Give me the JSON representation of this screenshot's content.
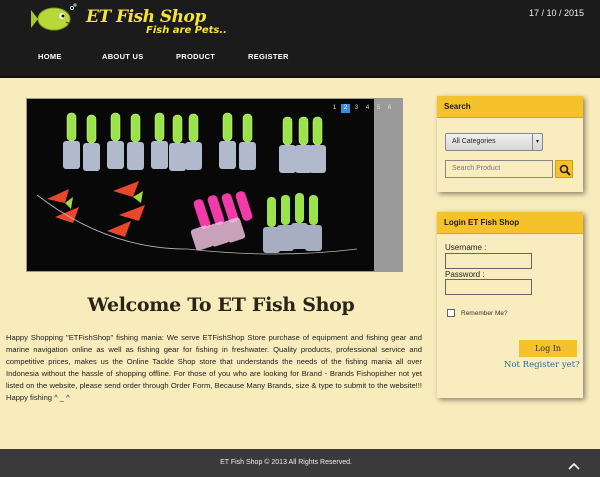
{
  "header": {
    "brand_name": "ET Fish Shop",
    "tagline": "Fish are Pets..",
    "date": "17 / 10 / 2015",
    "nav": [
      {
        "label": "HOME"
      },
      {
        "label": "ABOUT US"
      },
      {
        "label": "PRODUCT"
      },
      {
        "label": "REGISTER"
      }
    ]
  },
  "slider": {
    "pages": [
      "1",
      "2",
      "3",
      "4",
      "5",
      "6"
    ],
    "active_page": "2"
  },
  "welcome": {
    "title": "Welcome To ET Fish Shop",
    "text": "Happy Shopping \"ETFishShop\" fishing mania: We serve ETFishShop Store purchase of equipment and fishing gear and marine navigation online as well as fishing gear for fishing in freshwater. Quality products, professional service and competitive prices, makes us the Online Tackle Shop store that understands the needs of the fishing mania all over Indonesia without the hassle of shopping offline. For those of you who are looking for Brand - Brands Fishopisher not yet listed on the website, please send order through Order Form, Because Many Brands, size & type to submit to the website!!! Happy fishing ^ _ ^"
  },
  "search_panel": {
    "title": "Search",
    "category_selected": "All Categories",
    "search_placeholder": "Search Product"
  },
  "login_panel": {
    "title": "Login ET Fish Shop",
    "username_label": "Username :",
    "password_label": "Password :",
    "remember_label": "Remember Me?",
    "login_button": "Log In",
    "register_link": "Not Register yet?"
  },
  "footer": {
    "copyright": "ET Fish Shop © 2013 All Rights Reserved."
  },
  "colors": {
    "accent": "#f6c22c",
    "background": "#f8ecbc",
    "header": "#1b1b1b",
    "footer": "#3a3a3a",
    "link": "#1f6f9c"
  }
}
